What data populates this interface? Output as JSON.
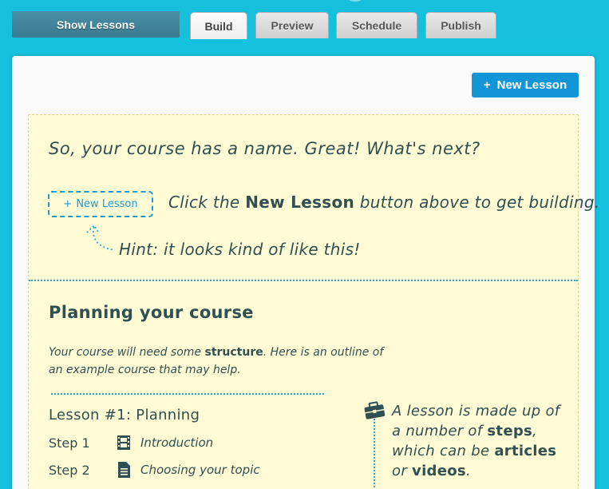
{
  "nav": {
    "show_lessons": "Show Lessons",
    "tabs": [
      {
        "label": "Build",
        "active": true
      },
      {
        "label": "Preview",
        "active": false
      },
      {
        "label": "Schedule",
        "active": false
      },
      {
        "label": "Publish",
        "active": false
      }
    ]
  },
  "toolbar": {
    "new_lesson_label": "New Lesson",
    "new_lesson_icon": "plus-icon"
  },
  "intro": {
    "title": "So, your course has a name. Great! What's next?",
    "mini_button_label": "New Lesson",
    "click_pre": "Click the ",
    "click_bold": "New Lesson",
    "click_post": " button above to get building.",
    "hint": "Hint: it looks kind of like this!"
  },
  "planning": {
    "title": "Planning your course",
    "desc_pre": "Your course will need some ",
    "desc_bold": "structure",
    "desc_post": ". Here is an outline of an example course that may help.",
    "lesson_heading": "Lesson #1: Planning",
    "steps": [
      {
        "num": "Step 1",
        "icon": "film-icon",
        "name": "Introduction"
      },
      {
        "num": "Step 2",
        "icon": "document-icon",
        "name": "Choosing your topic"
      }
    ],
    "note": {
      "p1": "A lesson is made up of a number of ",
      "b1": "steps",
      "p2": ", which can be ",
      "b2": "articles",
      "p3": " or ",
      "b3": "videos",
      "p4": "."
    }
  },
  "colors": {
    "accent": "#1396d8",
    "topbar": "#16c0dd",
    "notepad": "#fffcd5"
  }
}
